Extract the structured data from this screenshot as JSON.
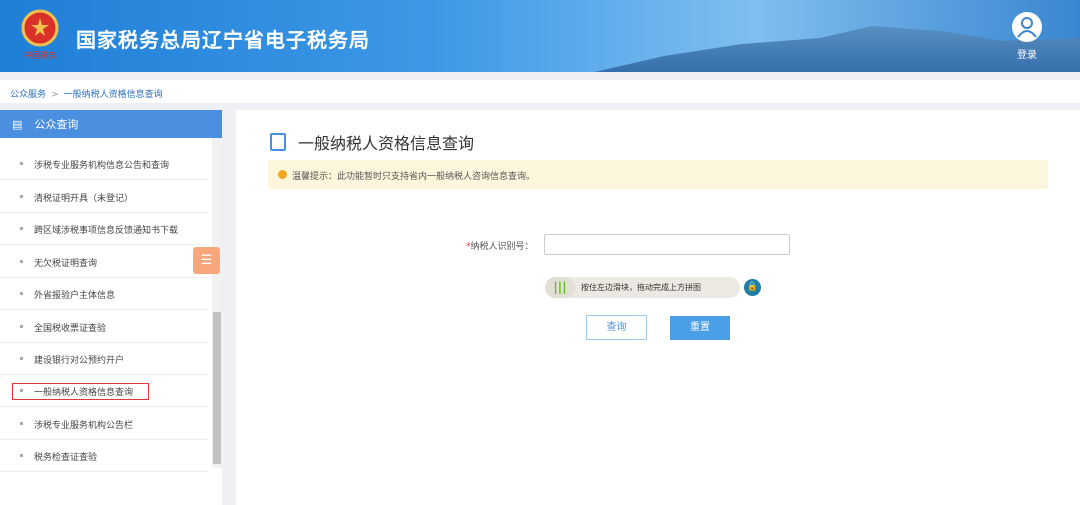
{
  "header": {
    "title": "国家税务总局辽宁省电子税务局",
    "login": "登录",
    "logo_text": "中国税务"
  },
  "breadcrumb": {
    "items": [
      "公众服务",
      "一般纳税人资格信息查询"
    ],
    "sep": ">"
  },
  "sidebar": {
    "title": "公众查询",
    "items": [
      "涉税专业服务机构信息公告和查询",
      "清税证明开具（未登记）",
      "跨区域涉税事项信息反馈通知书下载",
      "无欠税证明查询",
      "外省报验户主体信息",
      "全国税收票证查验",
      "建设银行对公预约开户",
      "一般纳税人资格信息查询",
      "涉税专业服务机构公告栏",
      "税务检查证查验"
    ]
  },
  "main": {
    "title": "一般纳税人资格信息查询",
    "tip": "温馨提示：此功能暂时只支持省内一般纳税人咨询信息查询。",
    "field_required": "*",
    "field_label": "纳税人识别号：",
    "field_value": "",
    "slider_text": "按住左边滑块，拖动完成上方拼图",
    "query": "查询",
    "reset": "重置"
  }
}
